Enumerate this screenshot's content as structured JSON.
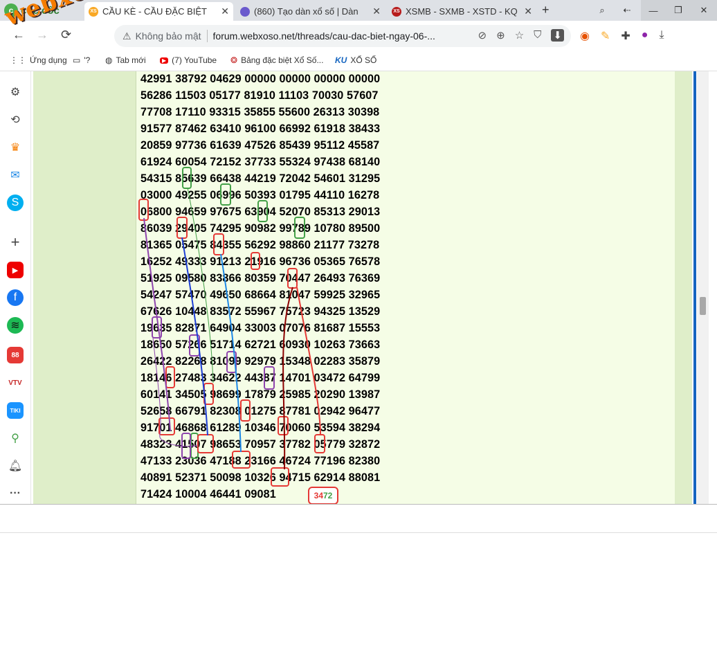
{
  "browser": {
    "brand": "cốc cốc",
    "tabs": [
      {
        "title": "CẦU KÈ - CẦU ĐẶC BIỆT",
        "active": true,
        "favicon_color": "#f9a825",
        "favicon_text": "XS"
      },
      {
        "title": "(860) Tạo dàn xổ số | Dàn",
        "active": false,
        "favicon_color": "#6a5acd",
        "favicon_text": ""
      },
      {
        "title": "XSMB - SXMB - XSTD - KQ",
        "active": false,
        "favicon_color": "#b71c1c",
        "favicon_text": "XS"
      }
    ],
    "new_tab": "+",
    "security_label": "Không bảo mật",
    "url": "forum.webxoso.net/threads/cau-dac-biet-ngay-06-...",
    "bookmarks": [
      {
        "label": "Ứng dụng",
        "icon": "apps-icon"
      },
      {
        "label": "'?",
        "icon": "folder-icon"
      },
      {
        "label": "Tab mới",
        "icon": "globe-icon"
      },
      {
        "label": "(7) YouTube",
        "icon": "youtube-icon"
      },
      {
        "label": "Bảng đặc biệt Xổ Số...",
        "icon": "site-icon"
      },
      {
        "label": "XỔ SỐ",
        "icon": "ku-icon"
      }
    ]
  },
  "watermark": "webxoso.net",
  "sidebar_icons": [
    "settings-icon",
    "history-icon",
    "crown-icon",
    "messenger-icon",
    "skype-icon",
    "add-icon",
    "youtube-icon",
    "facebook-icon",
    "spotify-icon",
    "app88-icon",
    "vtv-icon",
    "tiki-icon",
    "maps-icon",
    "bell-icon",
    "more-icon"
  ],
  "table": {
    "rows": [
      "42991 38792 04629 00000 00000 00000 00000",
      "56286 11503 05177 81910 11103 70030 57607",
      "77708 17110 93315 35855 55600 26313 30398",
      "91577 87462 63410 96100 66992 61918 38433",
      "20859 97736 61639 47526 85439 95112 45587",
      "61924 60054 72152 37733 55324 97438 68140",
      "54315 85639 66438 44219 72042 54601 31295",
      "03000 49255 06996 50393 01795 44110 16278",
      "06800 94659 97675 63904 52070 85313 29013",
      "86039 29405 74295 90982 99789 10780 89500",
      "81365 05475 84355 56292 98860 21177 73278",
      "16252 49333 91213 21916 96736 05365 76578",
      "51925 09580 83866 80359 70447 26493 76369",
      "54247 57470 49650 68664 81047 59925 32965",
      "67626 10448 83572 55967 75723 94325 13529",
      "19635 82871 64904 33003 07076 81687 15553",
      "18650 57266 51714 62721 60930 10263 73663",
      "26422 82268 81099 92979 15348 02283 35879",
      "18146 27483 34622 44387 14701 03472 64799",
      "60141 34505 98699 17879 25985 20290 13987",
      "52658 66791 82308 01275 87781 02942 96477",
      "91701 46868 61289 10346 70060 53594 38294",
      "48323 41507 98653 70957 37782 05779 32872",
      "47133 23036 47188 23166 46724 77196 82380",
      "40891 52371 50098 10326 94715 62914 88081",
      "71424 10004 46441 09081"
    ],
    "result_badge": {
      "part1": "34",
      "part2": "72"
    },
    "colors": {
      "red": "#e53935",
      "green": "#43a047",
      "purple": "#8e44ad",
      "blue": "#1e3fd6",
      "cyan": "#1e88e5",
      "darkred": "#8b0000"
    }
  }
}
